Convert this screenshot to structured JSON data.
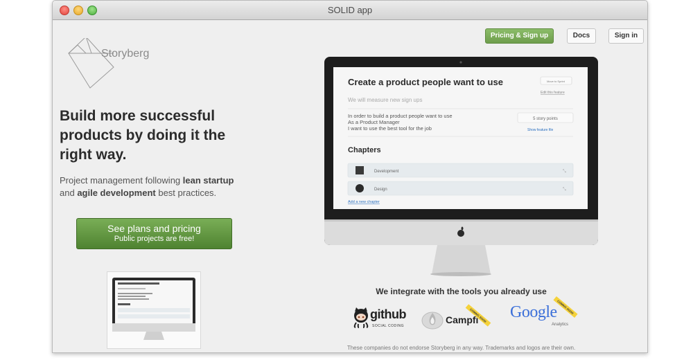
{
  "window": {
    "title": "SOLID app"
  },
  "brand": {
    "name": "Storyberg"
  },
  "nav": {
    "pricing": "Pricing & Sign up",
    "docs": "Docs",
    "signin": "Sign in"
  },
  "hero": {
    "headline": "Build more successful products by doing it the right way.",
    "sub_pre": "Project management following ",
    "sub_bold1": "lean startup",
    "sub_mid": " and ",
    "sub_bold2": "agile development",
    "sub_post": " best practices."
  },
  "cta": {
    "main": "See plans and pricing",
    "sub": "Public projects are free!"
  },
  "screen": {
    "title": "Create a product people want to use",
    "move_label": "Move to Sprint",
    "edit_link": "Edit this feature",
    "measure": "We will measure new sign ups",
    "story": [
      "In order to build a product people want to use",
      "As a Product Manager",
      "I want to use the best tool for the job"
    ],
    "points": "5 story points",
    "show_file": "Show feature file",
    "chapters_heading": "Chapters",
    "chapters": [
      "Development",
      "Design"
    ],
    "add_chapter": "Add a new chapter"
  },
  "integrations": {
    "heading": "We integrate with the tools you already use",
    "github": "github",
    "github_sub": "SOCIAL CODING",
    "campfire": "Campfi",
    "campfire_ribbon": "COMING SOON",
    "google": "Google",
    "google_sub": "Analytics",
    "google_ribbon": "COMING SOON",
    "disclaimer": "These companies do not endorse Storyberg in any way. Trademarks and logos are their own."
  },
  "colors": {
    "accent_green": "#6e9d4c",
    "window_bg": "#efefef",
    "text_dark": "#2b2b2b"
  }
}
